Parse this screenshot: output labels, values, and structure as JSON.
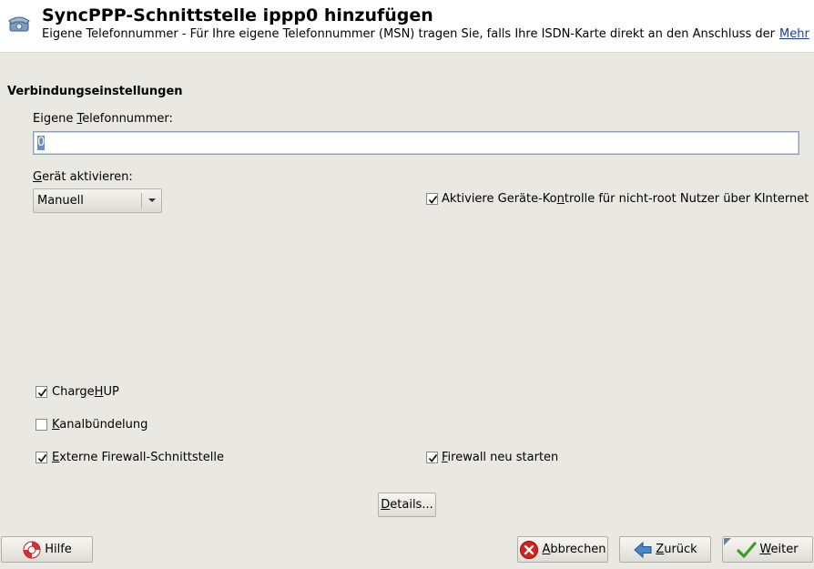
{
  "header": {
    "title": "SyncPPP-Schnittstelle ippp0 hinzufügen",
    "description": "Eigene Telefonnummer - Für Ihre eigene Telefonnummer (MSN) tragen Sie, falls Ihre ISDN-Karte direkt an den Anschluss der ...",
    "more_link": "Mehr",
    "icon": "telephone-icon"
  },
  "section": {
    "title": "Verbindungseinstellungen"
  },
  "phone": {
    "label_pre": "Eigene ",
    "label_key": "T",
    "label_post": "elefonnummer:",
    "value": "0"
  },
  "device": {
    "label_pre": "",
    "label_key": "G",
    "label_post": "erät aktivieren:",
    "selected": "Manuell"
  },
  "checkboxes": {
    "geraete_kontrolle": {
      "pre": "Aktiviere Geräte-Ko",
      "key": "n",
      "post": "trolle für nicht-root Nutzer über KInternet",
      "checked": true
    },
    "chargehup": {
      "pre": "Charge",
      "key": "H",
      "post": "UP",
      "checked": true
    },
    "kanalbuendelung": {
      "pre": "",
      "key": "K",
      "post": "analbündelung",
      "checked": false
    },
    "externe_firewall": {
      "pre": "",
      "key": "E",
      "post": "xterne Firewall-Schnittstelle",
      "checked": true
    },
    "firewall_neu": {
      "pre": "",
      "key": "F",
      "post": "irewall neu starten",
      "checked": true
    }
  },
  "buttons": {
    "details": {
      "pre": "",
      "key": "D",
      "post": "etails..."
    },
    "hilfe": {
      "label": "Hilfe",
      "icon": "lifebuoy-icon"
    },
    "abbrechen": {
      "pre": "",
      "key": "A",
      "post": "bbrechen",
      "icon": "cancel-icon"
    },
    "zurueck": {
      "pre": "",
      "key": "Z",
      "post": "urück",
      "icon": "back-arrow-icon"
    },
    "weiter": {
      "pre": "",
      "key": "W",
      "post": "eiter",
      "icon": "checkmark-icon"
    }
  },
  "colors": {
    "background": "#e9e8e3",
    "header_background": "#ffffff",
    "link": "#1a3d9a",
    "selection": "#6d8cc4"
  }
}
